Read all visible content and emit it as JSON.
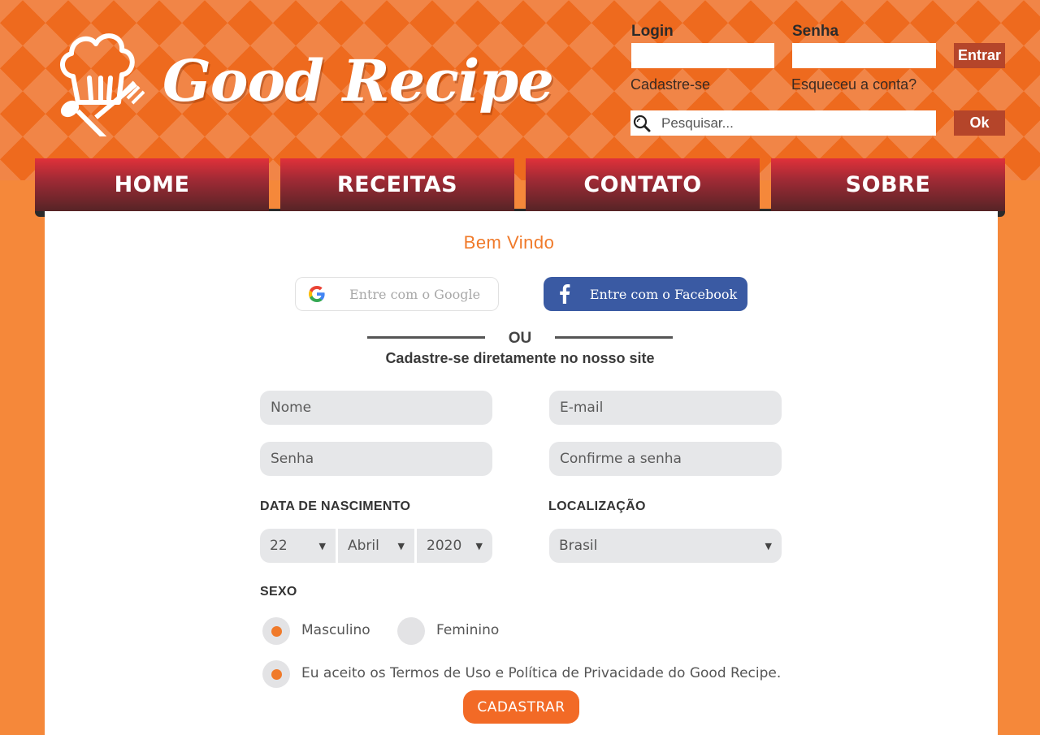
{
  "brand": {
    "name": "Good Recipe"
  },
  "login": {
    "login_label": "Login",
    "password_label": "Senha",
    "login_value": "",
    "password_value": "",
    "enter_button": "Entrar",
    "register_link": "Cadastre-se",
    "forgot_link": "Esqueceu a conta?"
  },
  "search": {
    "placeholder": "Pesquisar...",
    "button": "Ok"
  },
  "nav": {
    "items": [
      {
        "label": "HOME"
      },
      {
        "label": "RECEITAS"
      },
      {
        "label": "CONTATO"
      },
      {
        "label": "SOBRE"
      }
    ]
  },
  "signup": {
    "welcome": "Bem Vindo",
    "google_button": "Entre com o Google",
    "facebook_button": "Entre com o Facebook",
    "or_text": "OU",
    "subtitle": "Cadastre-se diretamente no nosso site",
    "name_placeholder": "Nome",
    "email_placeholder": "E-mail",
    "password_placeholder": "Senha",
    "confirm_placeholder": "Confirme a senha",
    "birth_label": "DATA DE NASCIMENTO",
    "birth_day": "22",
    "birth_month": "Abril",
    "birth_year": "2020",
    "location_label": "LOCALIZAÇÃO",
    "location_value": "Brasil",
    "sex_label": "SEXO",
    "sex_options": [
      {
        "label": "Masculino",
        "selected": true
      },
      {
        "label": "Feminino",
        "selected": false
      }
    ],
    "terms_text": "Eu aceito os Termos de Uso e Política de Privacidade do Good Recipe.",
    "terms_checked": true,
    "submit_button": "CADASTRAR"
  },
  "colors": {
    "accent": "#f07a2a",
    "header": "#ee6a1e",
    "nav_red": "#a02a35",
    "facebook": "#3a5aa3",
    "button_dark": "#b5452a"
  },
  "icons": {
    "logo": "chef-hat-spoon-fork-icon",
    "search": "search-icon",
    "google": "google-icon",
    "facebook": "facebook-icon",
    "dropdown": "chevron-down-icon"
  }
}
